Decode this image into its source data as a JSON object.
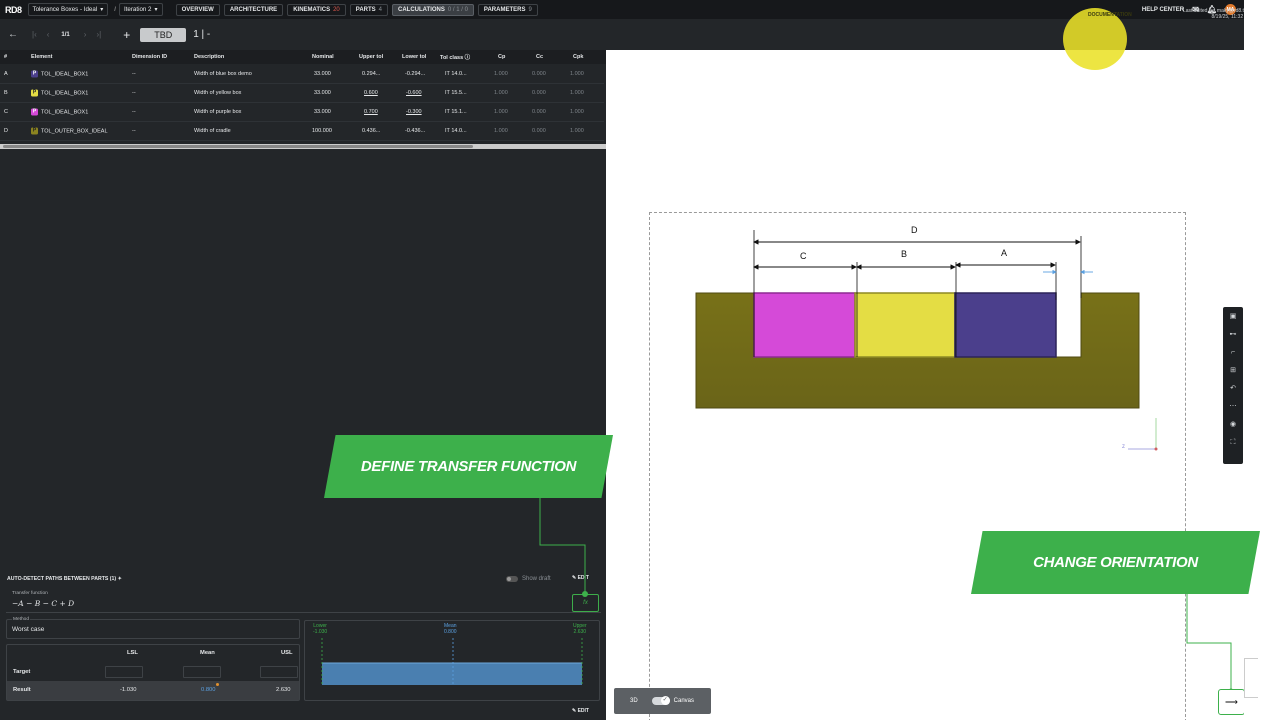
{
  "app": {
    "logo": "RD8",
    "project": "Tolerance Boxes - Ideal",
    "iteration": "Iteration 2"
  },
  "tabs": [
    {
      "label": "OVERVIEW",
      "count": ""
    },
    {
      "label": "ARCHITECTURE",
      "count": ""
    },
    {
      "label": "KINEMATICS",
      "count": "20"
    },
    {
      "label": "PARTS",
      "count": "4"
    },
    {
      "label": "CALCULATIONS",
      "count": "0 / 1 / 0"
    },
    {
      "label": "PARAMETERS",
      "count": "9"
    }
  ],
  "header": {
    "help_center": "HELP CENTER",
    "avatar": "MA",
    "documentation": "DOCUMENTATION",
    "last_edited_line1": "Last edited by: maky@rd8.tech",
    "last_edited_line2": "8/19/25, 11:32 PM"
  },
  "toolbar": {
    "page": "1/1",
    "tbd": "TBD",
    "suffix": "1 | -"
  },
  "table": {
    "headers": {
      "num": "#",
      "element": "Element",
      "dim_id": "Dimension ID",
      "description": "Description",
      "nominal": "Nominal",
      "upper": "Upper tol",
      "lower": "Lower tol",
      "tolclass": "Tol class",
      "cp": "Cp",
      "cc": "Cc",
      "cpk": "Cpk"
    },
    "rows": [
      {
        "num": "A",
        "icon": "P",
        "element": "TOL_IDEAL_BOX1",
        "dim_id": "--",
        "description": "Width of blue box demo",
        "nominal": "33.000",
        "upper": "0.294...",
        "lower": "-0.294...",
        "tolclass": "IT 14.0...",
        "cp": "1.000",
        "cc": "0.000",
        "cpk": "1.000"
      },
      {
        "num": "B",
        "icon": "P",
        "element": "TOL_IDEAL_BOX1",
        "dim_id": "--",
        "description": "Width of yellow box",
        "nominal": "33.000",
        "upper": "0.600",
        "lower": "-0.600",
        "tolclass": "IT 15.5...",
        "cp": "1.000",
        "cc": "0.000",
        "cpk": "1.000"
      },
      {
        "num": "C",
        "icon": "P",
        "element": "TOL_IDEAL_BOX1",
        "dim_id": "--",
        "description": "Width of purple box",
        "nominal": "33.000",
        "upper": "0.700",
        "lower": "-0.300",
        "tolclass": "IT 15.1...",
        "cp": "1.000",
        "cc": "0.000",
        "cpk": "1.000"
      },
      {
        "num": "D",
        "icon": "P",
        "element": "TOL_OUTER_BOX_IDEAL",
        "dim_id": "--",
        "description": "Width of cradle",
        "nominal": "100.000",
        "upper": "0.436...",
        "lower": "-0.436...",
        "tolclass": "IT 14.0...",
        "cp": "1.000",
        "cc": "0.000",
        "cpk": "1.000"
      }
    ]
  },
  "colors": {
    "A": "#4b3f8c",
    "B": "#e4dd44",
    "C": "#d54ad8",
    "D": "#8b8420",
    "accent": "#3db04b",
    "mean": "#5ba0e0"
  },
  "calc": {
    "auto_detect": "AUTO-DETECT PATHS BETWEEN PARTS (1)",
    "show_draft": "Show draft",
    "edit": "EDIT",
    "tf_label": "Transfer function",
    "tf_value": "−A − B − C + D",
    "fx": "fx",
    "method_label": "Method",
    "method_value": "Worst case",
    "lsl": "LSL",
    "mean": "Mean",
    "usl": "USL",
    "target_label": "Target",
    "result_label": "Result",
    "result_lsl": "-1.030",
    "result_mean": "0.800",
    "result_usl": "2.630",
    "chart_lower_label": "Lower",
    "chart_lower_val": "-1.030",
    "chart_mean_label": "Mean",
    "chart_mean_val": "0.800",
    "chart_upper_label": "Upper",
    "chart_upper_val": "2.630"
  },
  "canvas": {
    "dim_labels": {
      "D": "D",
      "C": "C",
      "B": "B",
      "A": "A"
    },
    "toggle_3d": "3D",
    "toggle_canvas": "Canvas",
    "axis_z": "z"
  },
  "callouts": {
    "define": "DEFINE TRANSFER FUNCTION",
    "change": "CHANGE ORIENTATION"
  }
}
